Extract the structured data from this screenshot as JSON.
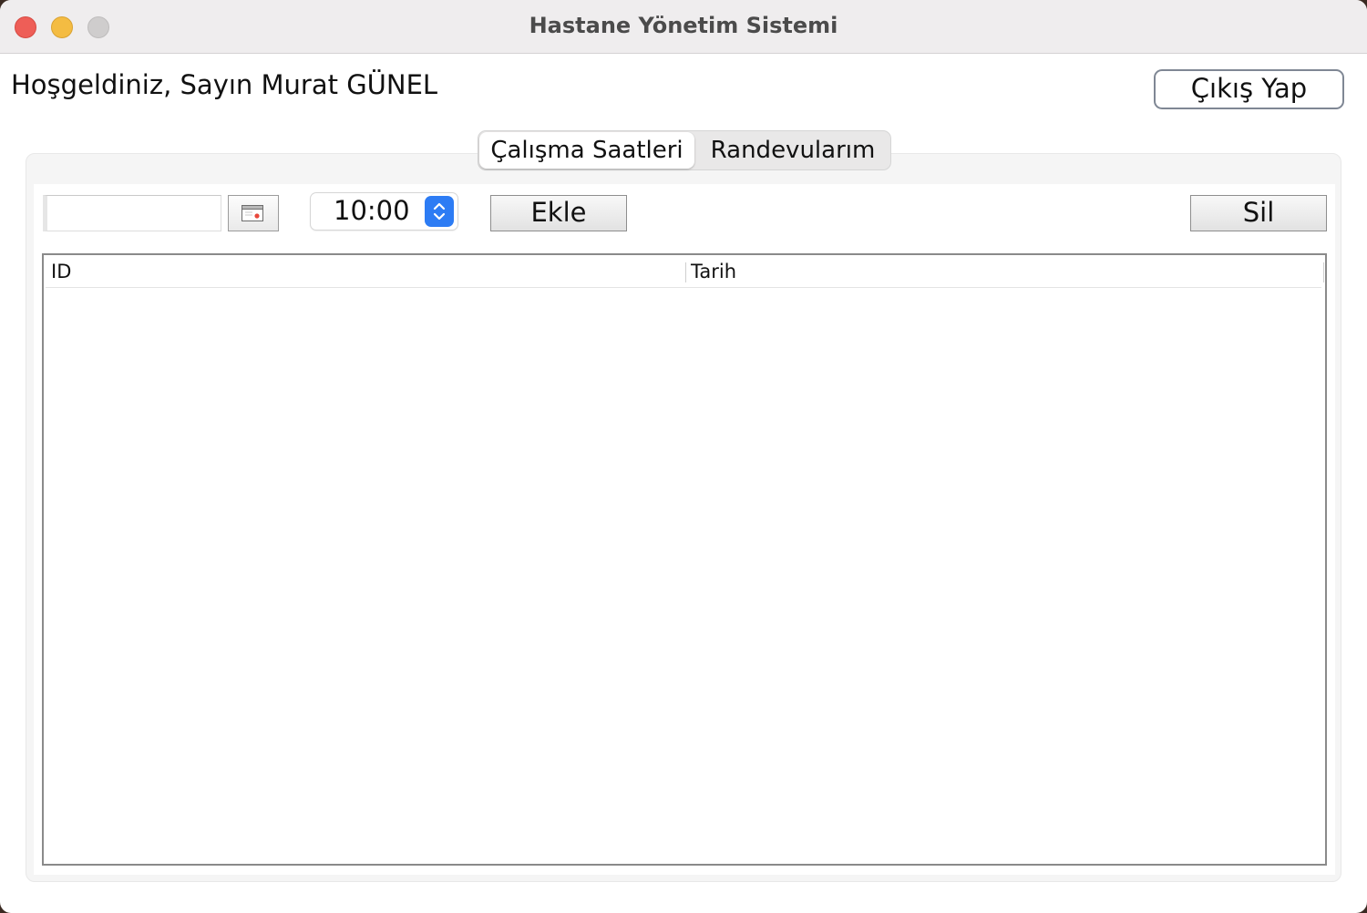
{
  "window": {
    "title": "Hastane Yönetim Sistemi"
  },
  "header": {
    "welcome_text": "Hoşgeldiniz, Sayın Murat GÜNEL",
    "logout_label": "Çıkış Yap"
  },
  "tabs": [
    {
      "label": "Çalışma Saatleri",
      "selected": true
    },
    {
      "label": "Randevularım",
      "selected": false
    }
  ],
  "toolbar": {
    "date_value": "",
    "calendar_icon": "calendar-icon",
    "time_value": "10:00",
    "add_label": "Ekle",
    "delete_label": "Sil"
  },
  "table": {
    "columns": [
      "ID",
      "Tarih"
    ],
    "rows": []
  },
  "colors": {
    "accent": "#2d7cf4",
    "close": "#ee5e57",
    "minimize": "#f4bc42",
    "zoom": "#cfcdcd"
  }
}
